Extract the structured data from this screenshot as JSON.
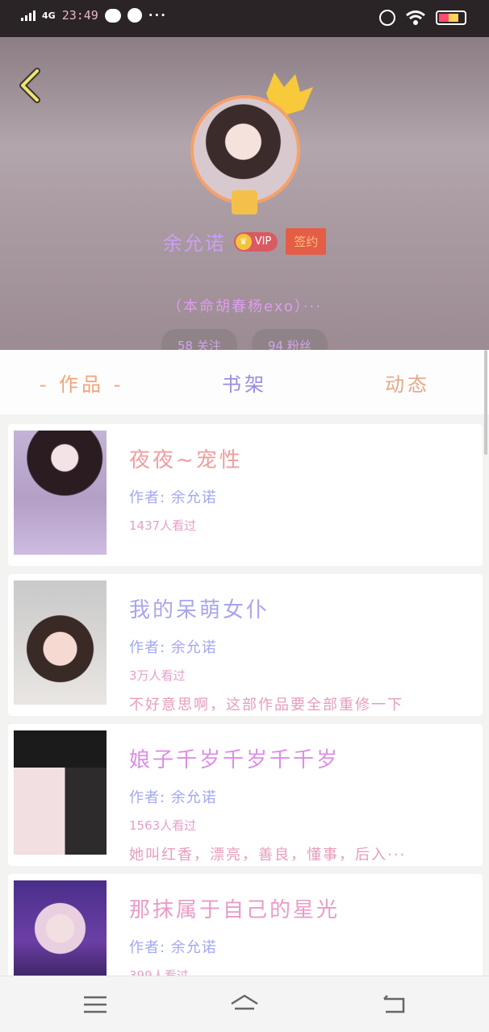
{
  "status": {
    "network": "4G",
    "network_sup": "HD",
    "time": "23:49",
    "dots": "···"
  },
  "profile": {
    "name": "余允诺",
    "vip_label": "VIP",
    "signed_label": "签约",
    "bio": "（本命胡春杨exo）···",
    "following": "58 关注",
    "fans": "94 粉丝"
  },
  "tabs": [
    {
      "label": "作品",
      "active": true
    },
    {
      "label": "书架",
      "active": false
    },
    {
      "label": "动态",
      "active": false
    }
  ],
  "works": [
    {
      "title": "夜夜~宠性",
      "title_color": "#ef9e9e",
      "author": "作者: 余允诺",
      "views": "1437人看过",
      "desc": ""
    },
    {
      "title": "我的呆萌女仆",
      "title_color": "#a7a6ee",
      "author": "作者: 余允诺",
      "views": "3万人看过",
      "desc": "不好意思啊，这部作品要全部重修一下"
    },
    {
      "title": "娘子千岁千岁千千岁",
      "title_color": "#dc8ee6",
      "author": "作者: 余允诺",
      "views": "1563人看过",
      "desc": "她叫红香，漂亮，善良，懂事，后入···"
    },
    {
      "title": "那抹属于自己的星光",
      "title_color": "#e89cc8",
      "author": "作者: 余允诺",
      "views": "399人看过",
      "desc": ""
    }
  ],
  "colors": {
    "header_bg": "#a89aa0",
    "accent_orange": "#f0a47c",
    "vip_red": "#d95b61",
    "signed_red": "#e35d47"
  }
}
